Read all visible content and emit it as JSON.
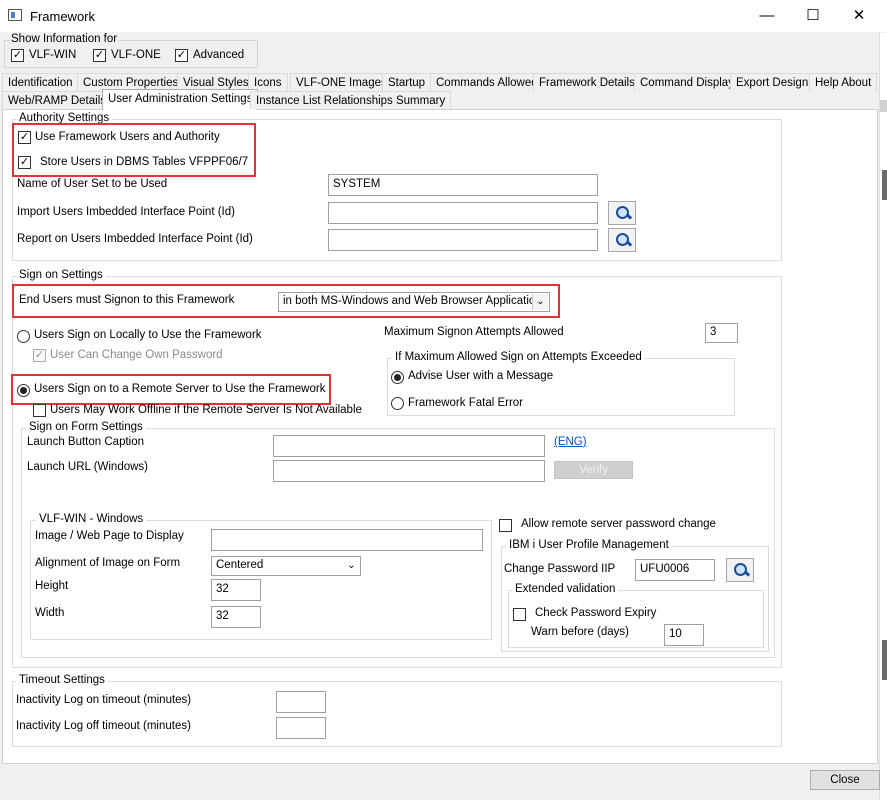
{
  "window": {
    "title": "Framework"
  },
  "show_info": {
    "title": "Show Information for",
    "options": [
      {
        "label": "VLF-WIN",
        "checked": true
      },
      {
        "label": "VLF-ONE",
        "checked": true
      },
      {
        "label": "Advanced",
        "checked": true
      }
    ]
  },
  "tabs_row1": [
    "Identification",
    "Custom Properties",
    "Visual Styles",
    "Icons",
    "VLF-ONE Images",
    "Startup",
    "Commands Allowed",
    "Framework Details",
    "Command Display",
    "Export Design",
    "Help About"
  ],
  "tabs_row2": [
    "Web/RAMP Details",
    "User Administration Settings",
    "Instance List Relationships Summary"
  ],
  "active_tab": "User Administration Settings",
  "authority": {
    "title": "Authority Settings",
    "use_framework_users": {
      "label": "Use Framework Users and Authority",
      "checked": true
    },
    "store_users": {
      "label": "Store Users in DBMS Tables VFPPF06/7",
      "checked": true
    },
    "user_set_label": "Name of User Set to be Used",
    "user_set_value": "SYSTEM",
    "import_label": "Import Users Imbedded Interface Point (Id)",
    "import_value": "",
    "report_label": "Report on Users Imbedded Interface Point (Id)",
    "report_value": ""
  },
  "signon": {
    "title": "Sign on Settings",
    "must_signon_label": "End Users must Signon to this Framework",
    "must_signon_value": "in both MS-Windows and Web Browser Applications",
    "local_label": "Users Sign on Locally to Use the Framework",
    "local_selected": false,
    "change_pw_label": "User Can Change Own Password",
    "change_pw_checked": true,
    "max_attempts_label": "Maximum Signon Attempts Allowed",
    "max_attempts_value": "3",
    "exceeded_title": "If Maximum Allowed Sign on Attempts Exceeded",
    "advise_label": "Advise User with a Message",
    "advise_selected": true,
    "fatal_label": "Framework Fatal Error",
    "fatal_selected": false,
    "remote_label": "Users Sign on to a Remote Server to Use the Framework",
    "remote_selected": true,
    "offline_label": "Users May Work Offline if the Remote Server Is Not Available",
    "offline_checked": false
  },
  "form_settings": {
    "title": "Sign on Form Settings",
    "caption_label": "Launch Button Caption",
    "caption_value": "",
    "eng_link": "(ENG)",
    "url_label": "Launch URL (Windows)",
    "url_value": "",
    "verify_label": "Verify",
    "vlfwin_title": "VLF-WIN - Windows",
    "image_label": "Image / Web Page to Display",
    "image_value": "",
    "align_label": "Alignment of Image on Form",
    "align_value": "Centered",
    "height_label": "Height",
    "height_value": "32",
    "width_label": "Width",
    "width_value": "32",
    "allow_remote_label": "Allow remote server password change",
    "allow_remote_checked": false,
    "ibm_title": "IBM i User Profile Management",
    "change_iip_label": "Change Password IIP",
    "change_iip_value": "UFU0006",
    "ext_title": "Extended validation",
    "check_expiry_label": "Check Password Expiry",
    "check_expiry_checked": false,
    "warn_label": "Warn before (days)",
    "warn_value": "10"
  },
  "timeout": {
    "title": "Timeout Settings",
    "logon_label": "Inactivity Log on timeout (minutes)",
    "logon_value": "",
    "logoff_label": "Inactivity Log off timeout (minutes)",
    "logoff_value": ""
  },
  "footer": {
    "close_label": "Close"
  },
  "colors": {
    "highlight": "#e53238",
    "link": "#0055cc"
  }
}
